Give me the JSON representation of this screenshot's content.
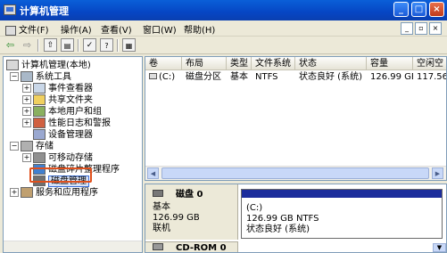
{
  "window": {
    "title": "计算机管理"
  },
  "menu": [
    {
      "label": "文件(F)"
    },
    {
      "label": "操作(A)"
    },
    {
      "label": "查看(V)"
    },
    {
      "label": "窗口(W)"
    },
    {
      "label": "帮助(H)"
    }
  ],
  "tree": {
    "root": "计算机管理(本地)",
    "system_tools": "系统工具",
    "event_viewer": "事件查看器",
    "shared_folders": "共享文件夹",
    "local_users": "本地用户和组",
    "perf_logs": "性能日志和警报",
    "device_manager": "设备管理器",
    "storage": "存储",
    "removable": "可移动存储",
    "defrag": "磁盘碎片整理程序",
    "disk_mgmt": "磁盘管理",
    "services": "服务和应用程序"
  },
  "list": {
    "columns": [
      "卷",
      "布局",
      "类型",
      "文件系统",
      "状态",
      "容量",
      "空闲空"
    ],
    "rows": [
      {
        "volume": "(C:)",
        "layout": "磁盘分区",
        "type": "基本",
        "fs": "NTFS",
        "status": "状态良好 (系统)",
        "capacity": "126.99 GB",
        "free": "117.56"
      }
    ]
  },
  "graph": {
    "disk0": {
      "name": "磁盘 0",
      "type": "基本",
      "size": "126.99 GB",
      "state": "联机"
    },
    "volume": {
      "label": "(C:)",
      "detail": "126.99 GB NTFS",
      "status": "状态良好 (系统)"
    },
    "cdrom": {
      "name": "CD-ROM 0"
    }
  },
  "colors": {
    "titlebar": "#0a5fd8",
    "volume_bar": "#1c2d9c",
    "highlight": "#e0501c"
  },
  "icons": [
    "computer-management-icon",
    "back-icon",
    "forward-icon",
    "up-icon",
    "show-hide-tree-icon",
    "properties-icon",
    "help-icon",
    "export-icon"
  ]
}
